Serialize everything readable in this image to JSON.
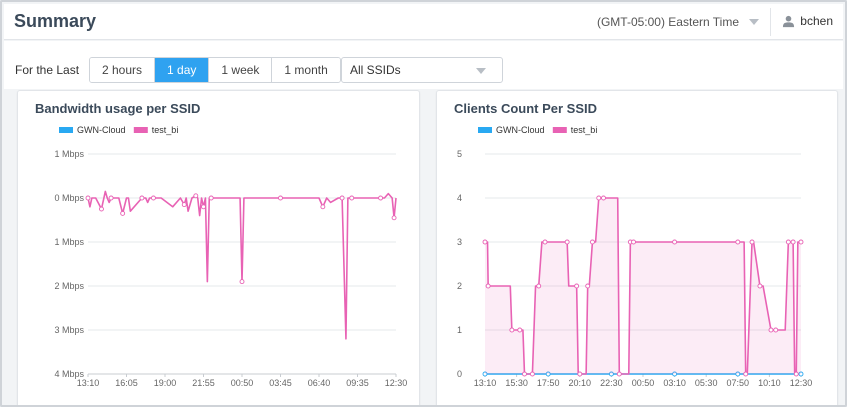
{
  "header": {
    "title": "Summary",
    "timezone": "(GMT-05:00) Eastern Time",
    "username": "bchen"
  },
  "filters": {
    "label": "For the Last",
    "ranges": [
      {
        "label": "2 hours",
        "active": false
      },
      {
        "label": "1 day",
        "active": true
      },
      {
        "label": "1 week",
        "active": false
      },
      {
        "label": "1 month",
        "active": false
      }
    ],
    "ssid_value": "All SSIDs"
  },
  "colors": {
    "accent": "#2fa2f0",
    "gwn_cloud": "#29a9f2",
    "test_bi": "#e862b4"
  },
  "chart_data": [
    {
      "type": "line",
      "title": "Bandwidth usage per SSID",
      "ytick_labels": [
        "1 Mbps",
        "0 Mbps",
        "1 Mbps",
        "2 Mbps",
        "3 Mbps",
        "4 Mbps"
      ],
      "yvals": [
        1,
        0,
        -1,
        -2,
        -3,
        -4
      ],
      "ylim": [
        -4,
        1
      ],
      "xtick_labels": [
        "13:10",
        "16:05",
        "19:00",
        "21:55",
        "00:50",
        "03:45",
        "06:40",
        "09:35",
        "12:30"
      ],
      "xlim": [
        0,
        8
      ],
      "grid": true,
      "legend_placement": "top-left",
      "series": [
        {
          "name": "GWN-Cloud",
          "color": "#29a9f2",
          "x": [],
          "y": []
        },
        {
          "name": "test_bi",
          "color": "#e862b4",
          "x": [
            0,
            0.05,
            0.1,
            0.2,
            0.35,
            0.45,
            0.5,
            0.55,
            0.6,
            0.7,
            0.75,
            0.8,
            0.9,
            1.0,
            1.05,
            1.1,
            1.4,
            1.5,
            1.55,
            1.6,
            1.7,
            1.9,
            2.2,
            2.4,
            2.5,
            2.55,
            2.6,
            2.7,
            2.8,
            2.85,
            2.9,
            2.95,
            3.0,
            3.05,
            3.1,
            3.15,
            3.2,
            3.3,
            3.5,
            3.95,
            4.0,
            4.05,
            4.3,
            4.5,
            5.0,
            5.5,
            5.9,
            6.0,
            6.1,
            6.2,
            6.3,
            6.5,
            6.6,
            6.7,
            6.75,
            6.8,
            6.85,
            6.9,
            7.2,
            7.5,
            7.6,
            7.7,
            7.8,
            7.9,
            7.95,
            8.0
          ],
          "y": [
            0,
            -0.2,
            0,
            0,
            -0.25,
            0.15,
            0,
            -0.1,
            0,
            0,
            0,
            0,
            -0.35,
            0,
            0,
            -0.3,
            0,
            0,
            -0.1,
            0,
            0,
            0,
            -0.2,
            0,
            -0.15,
            0,
            -0.3,
            0,
            0.05,
            0,
            -0.4,
            0,
            -0.2,
            0,
            -1.9,
            0,
            0,
            0,
            0,
            0,
            -1.9,
            0,
            0,
            0,
            0,
            0,
            0,
            0,
            -0.2,
            0,
            -0.1,
            0,
            0,
            -3.2,
            0,
            0,
            0,
            0,
            0,
            0,
            0,
            0,
            0.1,
            0,
            -0.45,
            0
          ]
        }
      ]
    },
    {
      "type": "area",
      "title": "Clients Count Per SSID",
      "yticks": [
        0,
        1,
        2,
        3,
        4,
        5
      ],
      "ylim": [
        0,
        5
      ],
      "xtick_labels": [
        "13:10",
        "15:30",
        "17:50",
        "20:10",
        "22:30",
        "00:50",
        "03:10",
        "05:30",
        "07:50",
        "10:10",
        "12:30"
      ],
      "xlim": [
        0,
        10
      ],
      "grid": true,
      "legend_placement": "top-left",
      "series": [
        {
          "name": "GWN-Cloud",
          "color": "#29a9f2",
          "x": [
            0,
            1,
            2,
            3,
            4,
            5,
            6,
            7,
            8,
            9,
            10
          ],
          "y": [
            0,
            0,
            0,
            0,
            0,
            0,
            0,
            0,
            0,
            0,
            0
          ]
        },
        {
          "name": "test_bi",
          "color": "#e862b4",
          "x": [
            0,
            0.08,
            0.1,
            0.8,
            0.85,
            1.0,
            1.1,
            1.2,
            1.25,
            1.4,
            1.5,
            1.6,
            1.7,
            1.8,
            1.9,
            2.0,
            2.6,
            2.65,
            2.9,
            2.95,
            3.0,
            3.2,
            3.25,
            3.3,
            3.4,
            3.5,
            3.6,
            3.7,
            3.75,
            4.2,
            4.25,
            4.55,
            4.6,
            4.65,
            4.7,
            5.0,
            6.0,
            7.0,
            8.0,
            8.2,
            8.25,
            8.3,
            8.45,
            8.5,
            8.7,
            8.8,
            9.05,
            9.1,
            9.2,
            9.5,
            9.6,
            9.7,
            9.75,
            9.8,
            9.85,
            9.9,
            10.0
          ],
          "y": [
            3,
            3,
            2,
            2,
            1,
            1,
            1,
            1,
            0,
            0,
            0,
            2,
            2,
            3,
            3,
            3,
            3,
            2,
            2,
            0,
            0,
            0,
            2,
            2,
            3,
            3,
            4,
            4,
            4,
            4,
            0,
            0,
            3,
            3,
            3,
            3,
            3,
            3,
            3,
            3,
            0,
            0,
            3,
            3,
            2,
            2,
            1,
            1,
            1,
            1,
            3,
            3,
            3,
            0,
            0,
            3,
            3
          ]
        }
      ]
    }
  ]
}
